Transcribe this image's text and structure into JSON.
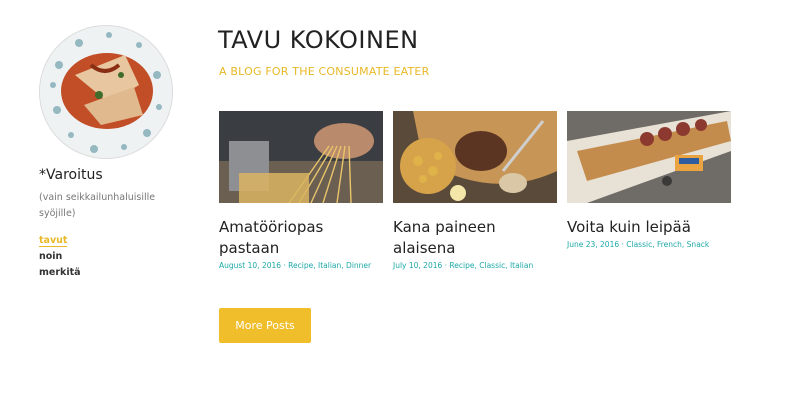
{
  "site": {
    "title": "TAVU KOKOINEN",
    "tagline": "A BLOG FOR THE CONSUMATE EATER"
  },
  "sidebar": {
    "warning": "*Varoitus",
    "note": "(vain seikkailunhaluisille syöjille)",
    "links": [
      {
        "label": "tavut",
        "active": true
      },
      {
        "label": "noin",
        "active": false
      },
      {
        "label": "merkitä",
        "active": false
      }
    ]
  },
  "posts": [
    {
      "title": "Amatööriopas pastaan",
      "meta": "August 10, 2016 · Recipe, Italian, Dinner"
    },
    {
      "title": "Kana paineen alaisena",
      "meta": "July 10, 2016 · Recipe, Classic, Italian"
    },
    {
      "title": "Voita kuin leipää",
      "meta": "June 23, 2016 · Classic, French, Snack"
    }
  ],
  "more_button": "More Posts",
  "colors": {
    "accent": "#f0be2b",
    "meta": "#1ea8a8"
  }
}
